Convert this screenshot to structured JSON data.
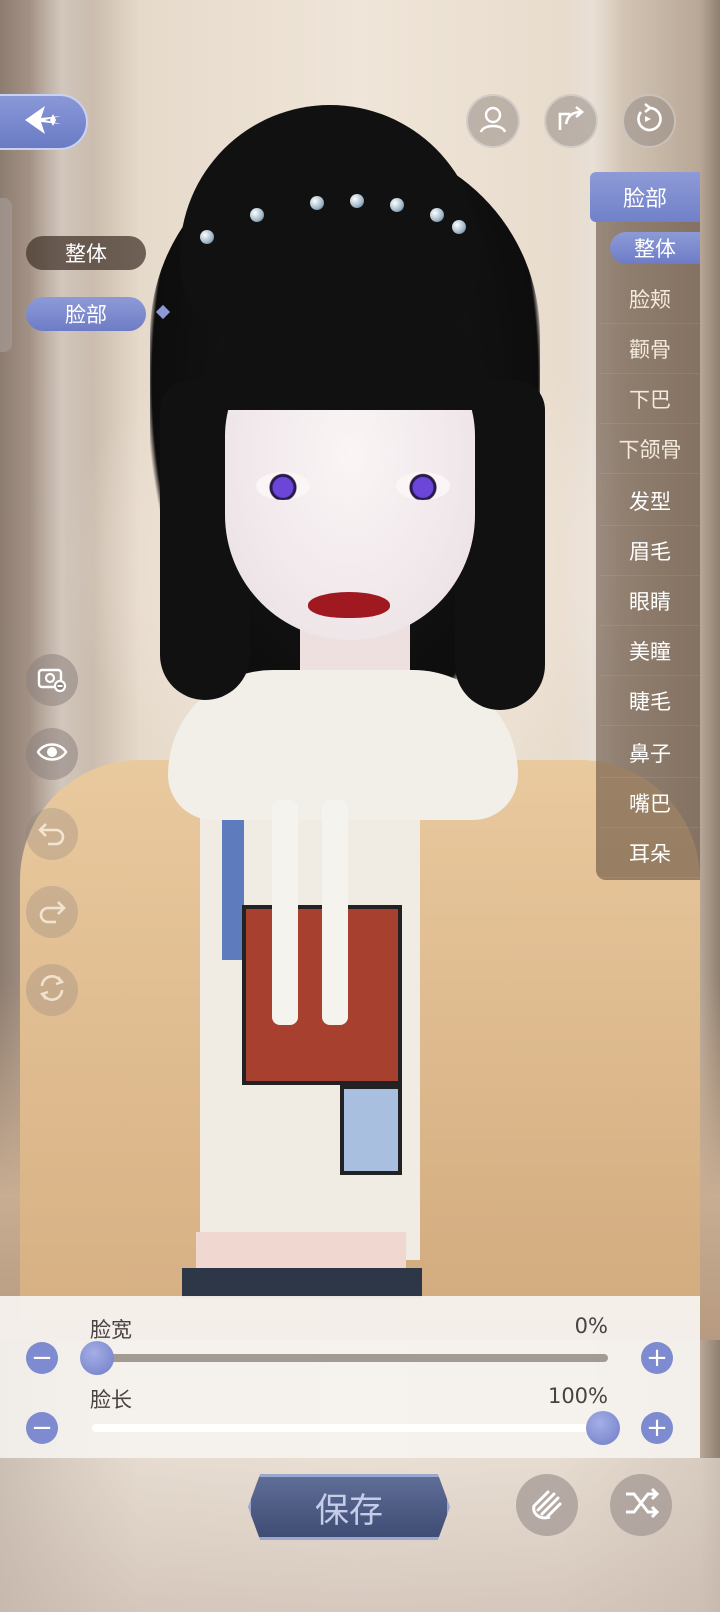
{
  "category_tabs": [
    {
      "label": "整体",
      "active": false
    },
    {
      "label": "脸部",
      "active": true
    }
  ],
  "right_menu": {
    "header": "脸部",
    "sub_items": [
      {
        "label": "整体",
        "active": true
      },
      {
        "label": "脸颊"
      },
      {
        "label": "颧骨"
      },
      {
        "label": "下巴"
      },
      {
        "label": "下颌骨"
      }
    ],
    "items": [
      {
        "label": "发型"
      },
      {
        "label": "眉毛"
      },
      {
        "label": "眼睛"
      },
      {
        "label": "美瞳"
      },
      {
        "label": "睫毛"
      },
      {
        "label": "鼻子"
      },
      {
        "label": "嘴巴"
      },
      {
        "label": "耳朵"
      }
    ]
  },
  "sliders": [
    {
      "label": "脸宽",
      "value_text": "0%",
      "value": 0
    },
    {
      "label": "脸长",
      "value_text": "100%",
      "value": 100
    }
  ],
  "bottom": {
    "save_label": "保存"
  },
  "icons": {
    "back": "back-arrow-icon",
    "top": [
      "portrait-icon",
      "share-icon",
      "reset-icon"
    ],
    "side_tools": [
      "camera-zoom-icon",
      "eye-icon",
      "undo-icon",
      "redo-icon",
      "rotate-icon"
    ],
    "bottom": [
      "hand-icon",
      "shuffle-icon"
    ]
  },
  "colors": {
    "accent": "#7f8bd0",
    "panel": "#f5f2ee",
    "save_button": "#4a5780"
  }
}
